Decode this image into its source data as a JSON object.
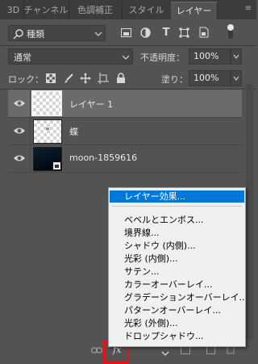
{
  "tabs": [
    {
      "label": "3D",
      "active": false
    },
    {
      "label": "チャンネル",
      "active": false
    },
    {
      "label": "色調補正",
      "active": false
    },
    {
      "label": "スタイル",
      "active": false
    },
    {
      "label": "レイヤー",
      "active": true
    }
  ],
  "filter": {
    "label": "種類",
    "icons": [
      "pixel-filter-icon",
      "adjustment-filter-icon",
      "type-filter-icon",
      "shape-filter-icon",
      "smart-object-filter-icon",
      "filter-toggle-icon"
    ]
  },
  "blend": {
    "mode": "通常",
    "opacity_label": "不透明度：",
    "opacity_value": "100%"
  },
  "lock": {
    "label": "ロック：",
    "fill_label": "塗り：",
    "fill_value": "100%"
  },
  "layers": [
    {
      "name": "レイヤー 1",
      "selected": true,
      "thumbnail": "transparent"
    },
    {
      "name": "蝶",
      "selected": false,
      "thumbnail": "transparent"
    },
    {
      "name": "moon-1859616",
      "selected": false,
      "thumbnail": "dark-image"
    }
  ],
  "fx_menu": {
    "header": "レイヤー効果...",
    "items": [
      "ベベルとエンボス...",
      "境界線...",
      "シャドウ (内側)...",
      "光彩 (内側)...",
      "サテン...",
      "カラーオーバーレイ...",
      "グラデーションオーバーレイ...",
      "パターンオーバーレイ...",
      "光彩 (外側)...",
      "ドロップシャドウ..."
    ]
  },
  "colors": {
    "panel_bg": "#535353",
    "menu_highlight": "#0078d7",
    "callout_red": "#e8131a"
  }
}
